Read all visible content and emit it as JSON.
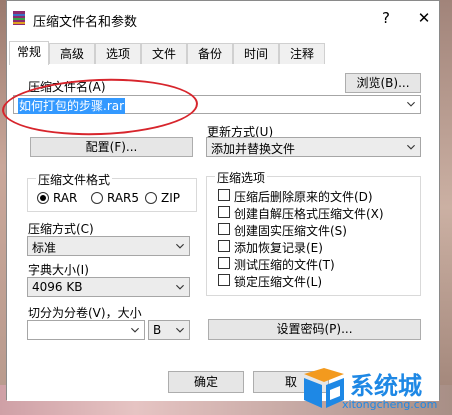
{
  "window": {
    "title": "压缩文件名和参数",
    "help": "?",
    "close": "✕"
  },
  "tabs": [
    "常规",
    "高级",
    "选项",
    "文件",
    "备份",
    "时间",
    "注释"
  ],
  "archive_name": {
    "label": "压缩文件名(A)",
    "value": "如何打包的步骤.rar",
    "browse": "浏览(B)..."
  },
  "profile_button": "配置(F)...",
  "update_mode": {
    "label": "更新方式(U)",
    "value": "添加并替换文件"
  },
  "format": {
    "title": "压缩文件格式",
    "options": [
      "RAR",
      "RAR5",
      "ZIP"
    ],
    "selected": "RAR"
  },
  "method": {
    "label": "压缩方式(C)",
    "value": "标准"
  },
  "dictionary": {
    "label": "字典大小(I)",
    "value": "4096 KB"
  },
  "split": {
    "label": "切分为分卷(V)，大小",
    "value": "",
    "unit": "B"
  },
  "options": {
    "title": "压缩选项",
    "items": [
      {
        "label": "压缩后删除原来的文件(D)",
        "checked": false
      },
      {
        "label": "创建自解压格式压缩文件(X)",
        "checked": false
      },
      {
        "label": "创建固实压缩文件(S)",
        "checked": false
      },
      {
        "label": "添加恢复记录(E)",
        "checked": false
      },
      {
        "label": "测试压缩的文件(T)",
        "checked": false
      },
      {
        "label": "锁定压缩文件(L)",
        "checked": false
      }
    ]
  },
  "set_password": "设置密码(P)...",
  "footer": {
    "ok": "确定",
    "cancel": "取"
  },
  "watermark": {
    "title": "系统城",
    "url": "xitongcheng.com",
    "colors": {
      "blue": "#1e88e5",
      "orange": "#f39a1e"
    }
  }
}
